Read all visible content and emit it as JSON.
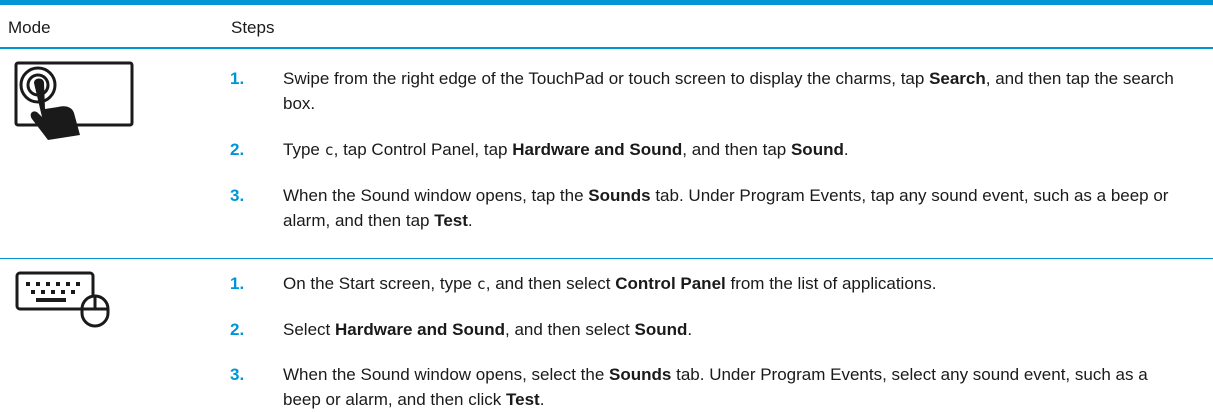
{
  "colors": {
    "accent": "#0096d6"
  },
  "table": {
    "header": {
      "mode": "Mode",
      "steps": "Steps"
    },
    "rows": [
      {
        "mode_icon": "touchpad-tap-icon",
        "steps": [
          {
            "num": "1.",
            "t1": "Swipe from the right edge of the TouchPad or touch screen to display the charms, tap ",
            "b1": "Search",
            "t2": ", and then tap the search box."
          },
          {
            "num": "2.",
            "t1": "Type ",
            "code": "c",
            "t2": ", tap Control Panel, tap ",
            "b1": "Hardware and Sound",
            "t3": ", and then tap ",
            "b2": "Sound",
            "t4": "."
          },
          {
            "num": "3.",
            "t1": "When the Sound window opens, tap the ",
            "b1": "Sounds",
            "t2": " tab. Under Program Events, tap any sound event, such as a beep or alarm, and then tap ",
            "b2": "Test",
            "t3": "."
          }
        ]
      },
      {
        "mode_icon": "keyboard-mouse-icon",
        "steps": [
          {
            "num": "1.",
            "t1": "On the Start screen, type ",
            "code": "c",
            "t2": ", and then select ",
            "b1": "Control Panel",
            "t3": " from the list of applications."
          },
          {
            "num": "2.",
            "t1": "Select ",
            "b1": "Hardware and Sound",
            "t2": ", and then select ",
            "b2": "Sound",
            "t3": "."
          },
          {
            "num": "3.",
            "t1": "When the Sound window opens, select the ",
            "b1": "Sounds",
            "t2": " tab. Under Program Events, select any sound event, such as a beep or alarm, and then click ",
            "b2": "Test",
            "t3": "."
          }
        ]
      }
    ]
  }
}
